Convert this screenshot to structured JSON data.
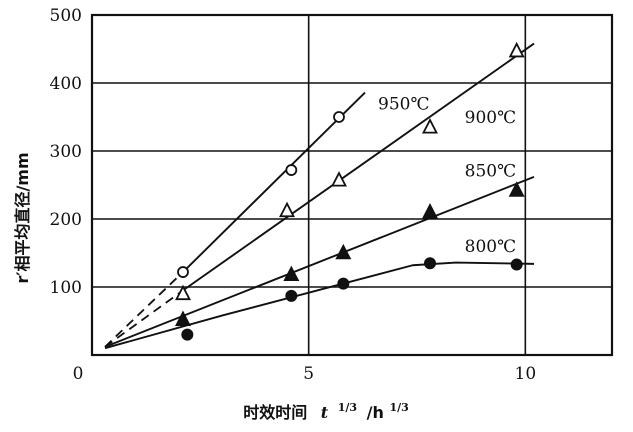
{
  "chart_data": {
    "type": "scatter",
    "title": "",
    "xlabel": {
      "prefix": "时效时间",
      "var": "t",
      "exp": "1/3",
      "unit": "/h",
      "unit_exp": "1/3"
    },
    "ylabel": "r′相平均直径/mm",
    "xlim": [
      0,
      12
    ],
    "ylim": [
      0,
      500
    ],
    "xticks": [
      0,
      5,
      10
    ],
    "yticks": [
      100,
      200,
      300,
      400,
      500
    ],
    "x_tick_labels": [
      "0",
      "5",
      "10"
    ],
    "y_tick_labels": [
      "100",
      "200",
      "300",
      "400",
      "500"
    ],
    "grid": true,
    "series": [
      {
        "name": "950℃",
        "marker": "circle-open",
        "points": [
          [
            2.1,
            122
          ],
          [
            4.6,
            272
          ],
          [
            5.7,
            350
          ]
        ],
        "fit_solid": [
          [
            2.1,
            122
          ],
          [
            6.3,
            386
          ]
        ],
        "fit_dashed": [
          [
            0.3,
            12
          ],
          [
            2.1,
            122
          ]
        ],
        "label_pos": [
          6.6,
          370
        ]
      },
      {
        "name": "900℃",
        "marker": "triangle-open",
        "points": [
          [
            2.1,
            90
          ],
          [
            4.5,
            212
          ],
          [
            5.7,
            257
          ],
          [
            7.8,
            335
          ],
          [
            9.8,
            447
          ]
        ],
        "fit_solid": [
          [
            2.1,
            95
          ],
          [
            10.2,
            458
          ]
        ],
        "fit_dashed": [
          [
            0.3,
            12
          ],
          [
            2.1,
            95
          ]
        ],
        "label_pos": [
          8.6,
          350
        ]
      },
      {
        "name": "850℃",
        "marker": "triangle-filled",
        "points": [
          [
            2.1,
            52
          ],
          [
            4.6,
            118
          ],
          [
            5.8,
            150
          ],
          [
            7.8,
            210
          ],
          [
            9.8,
            242
          ]
        ],
        "fit_solid": [
          [
            0.3,
            12
          ],
          [
            10.2,
            262
          ]
        ],
        "label_pos": [
          8.6,
          271
        ]
      },
      {
        "name": "800℃",
        "marker": "circle-filled",
        "points": [
          [
            2.2,
            30
          ],
          [
            4.6,
            87
          ],
          [
            5.8,
            105
          ],
          [
            7.8,
            135
          ],
          [
            9.8,
            133
          ]
        ],
        "fit_solid": [
          [
            0.3,
            10
          ],
          [
            3.0,
            58
          ],
          [
            5.8,
            105
          ],
          [
            7.4,
            132
          ],
          [
            8.4,
            136
          ],
          [
            10.2,
            134
          ]
        ],
        "label_pos": [
          8.6,
          160
        ]
      }
    ]
  }
}
